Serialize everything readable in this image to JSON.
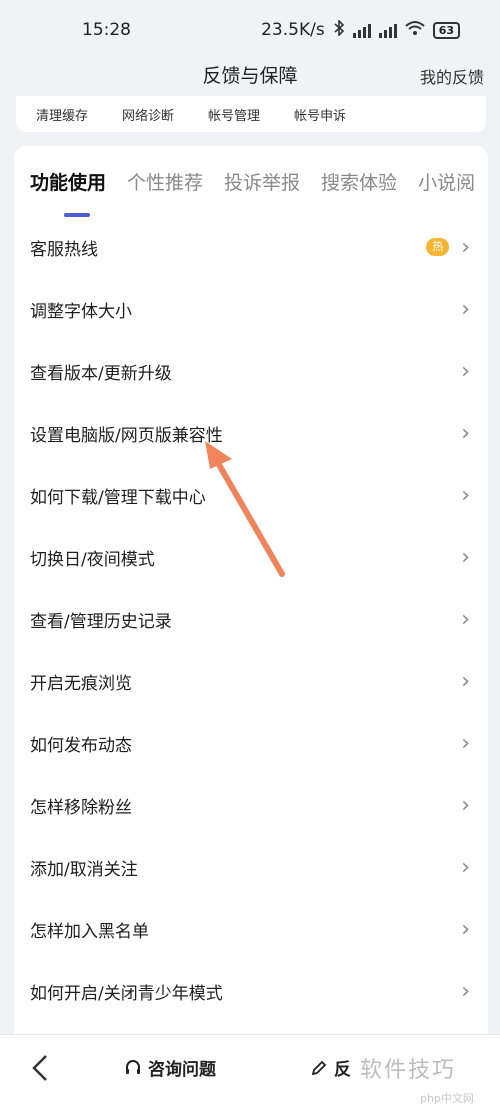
{
  "status_bar": {
    "time": "15:28",
    "net_speed": "23.5K/s",
    "battery": "63"
  },
  "nav": {
    "title": "反馈与保障",
    "right_link": "我的反馈"
  },
  "quick_actions": [
    "清理缓存",
    "网络诊断",
    "帐号管理",
    "帐号申诉"
  ],
  "tabs": [
    {
      "label": "功能使用",
      "active": true
    },
    {
      "label": "个性推荐",
      "active": false
    },
    {
      "label": "投诉举报",
      "active": false
    },
    {
      "label": "搜索体验",
      "active": false
    },
    {
      "label": "小说阅",
      "active": false
    }
  ],
  "list_items": [
    {
      "label": "客服热线",
      "badge": "热"
    },
    {
      "label": "调整字体大小"
    },
    {
      "label": "查看版本/更新升级"
    },
    {
      "label": "设置电脑版/网页版兼容性"
    },
    {
      "label": "如何下载/管理下载中心"
    },
    {
      "label": "切换日/夜间模式"
    },
    {
      "label": "查看/管理历史记录"
    },
    {
      "label": "开启无痕浏览"
    },
    {
      "label": "如何发布动态"
    },
    {
      "label": "怎样移除粉丝"
    },
    {
      "label": "添加/取消关注"
    },
    {
      "label": "怎样加入黑名单"
    },
    {
      "label": "如何开启/关闭青少年模式"
    }
  ],
  "bottom_bar": {
    "back_icon": "chevron-left-icon",
    "consult_label": "咨询问题",
    "feedback_label": "反"
  },
  "watermark": "软件技巧",
  "watermark_small": "php中文网",
  "colors": {
    "accent": "#4a5fd0",
    "badge": "#f3b532",
    "arrow": "#f0845a",
    "background": "#f1f2f6"
  }
}
